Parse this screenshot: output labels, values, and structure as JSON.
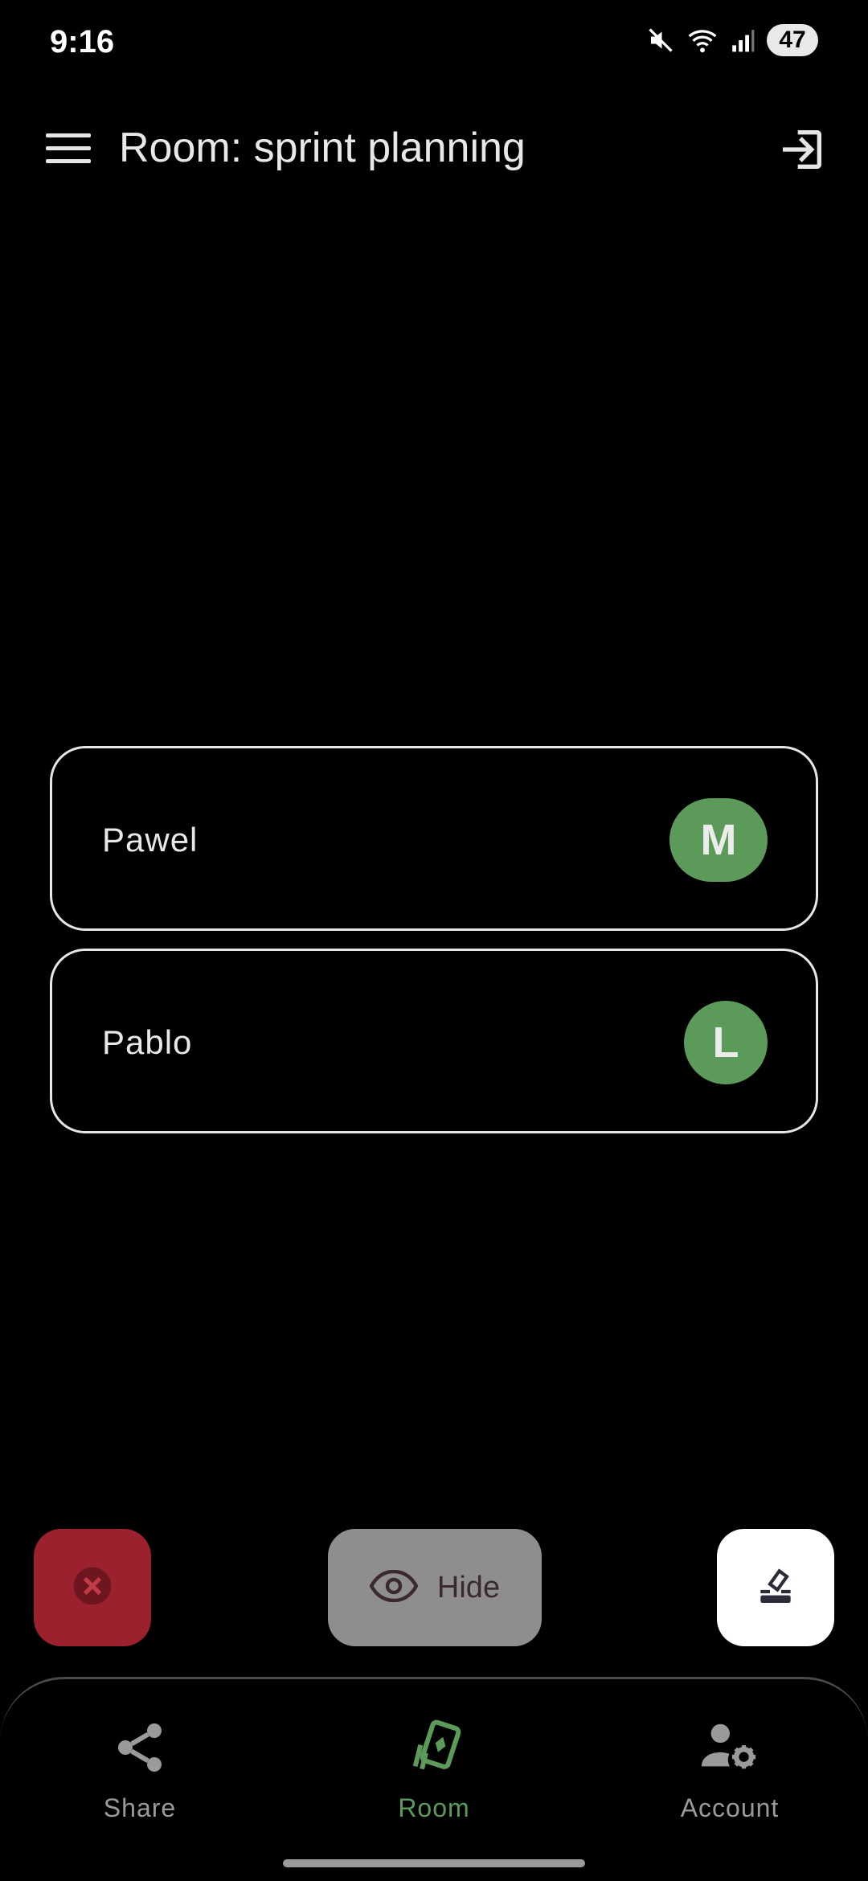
{
  "status_bar": {
    "time": "9:16",
    "battery": "47",
    "icons": [
      "mute-icon",
      "wifi-icon",
      "signal-icon",
      "battery-icon"
    ]
  },
  "app_bar": {
    "title": "Room: sprint planning",
    "menu_icon": "hamburger-menu-icon",
    "exit_icon": "exit-room-icon"
  },
  "participants": [
    {
      "name": "Pawel",
      "badge": "M"
    },
    {
      "name": "Pablo",
      "badge": "L"
    }
  ],
  "actions": {
    "clear_icon": "close-circle-icon",
    "hide_label": "Hide",
    "hide_icon": "eye-icon",
    "vote_icon": "ballot-box-icon"
  },
  "bottom_nav": {
    "items": [
      {
        "label": "Share",
        "icon": "share-icon",
        "active": false
      },
      {
        "label": "Room",
        "icon": "cards-icon",
        "active": true
      },
      {
        "label": "Account",
        "icon": "account-settings-icon",
        "active": false
      }
    ]
  },
  "colors": {
    "background": "#000000",
    "accent_green": "#5c9a5a",
    "danger_red": "#9b212e",
    "neutral_gray": "#8e8e8e"
  }
}
